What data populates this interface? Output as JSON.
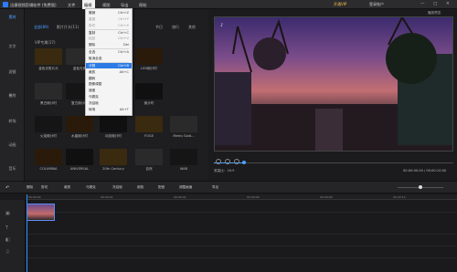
{
  "titlebar": {
    "app_title": "迅捷视频剪辑软件 (免费版)",
    "menu": [
      "文件",
      "编辑",
      "视图",
      "导出",
      "帮助"
    ],
    "vip": "开通VIP",
    "account": "登录账户",
    "window_controls": [
      "—",
      "□",
      "✕"
    ]
  },
  "sidebar": {
    "items": [
      "素材",
      "文字",
      "滤镜",
      "叠附",
      "转场",
      "动画",
      "音乐"
    ],
    "active_index": 0
  },
  "library": {
    "tabs": [
      "全部(89)",
      "影片片头(11)",
      "电影",
      "婚庆",
      "节日",
      "旅行",
      "其他"
    ],
    "active_tab": 0,
    "vip_label": "VIP专属(17)",
    "rows": [
      [
        {
          "label": "金色光斑片头"
        },
        {
          "label": "金色光斑"
        },
        {
          "label": "VIP"
        },
        {
          "label": "LED倒计时"
        }
      ],
      [
        {
          "label": "黑白倒计时"
        },
        {
          "label": "复古倒计时"
        },
        {
          "label": "古典倒计时"
        },
        {
          "label": "倒计时"
        }
      ],
      [
        {
          "label": "火焰倒计时"
        },
        {
          "label": "水晶倒计时"
        },
        {
          "label": "动态倒计时"
        },
        {
          "label": "FOGE"
        },
        {
          "label": "Metro Gold..."
        }
      ],
      [
        {
          "label": "COLUMBIA"
        },
        {
          "label": "UNIVERSAL"
        },
        {
          "label": "20th Century"
        },
        {
          "label": "自然"
        },
        {
          "label": "WAR"
        }
      ]
    ]
  },
  "edit_menu": {
    "items": [
      {
        "label": "撤销",
        "shortcut": "Ctrl+Z",
        "disabled": false
      },
      {
        "label": "重做",
        "shortcut": "Ctrl+Y",
        "disabled": true
      },
      {
        "label": "剪切",
        "shortcut": "Ctrl+X",
        "disabled": true
      },
      {
        "label": "复制",
        "shortcut": "Ctrl+C",
        "disabled": false
      },
      {
        "label": "粘贴",
        "shortcut": "Ctrl+V",
        "disabled": true
      },
      {
        "label": "删除",
        "shortcut": "Del",
        "disabled": false
      },
      {
        "label": "全选",
        "shortcut": "Ctrl+A",
        "disabled": false
      },
      {
        "label": "取消全选",
        "shortcut": "",
        "disabled": false
      },
      {
        "label": "分割",
        "shortcut": "Ctrl+B",
        "disabled": false,
        "highlight": true
      },
      {
        "label": "裁剪",
        "shortcut": "Alt+C",
        "disabled": false
      },
      {
        "label": "翻转",
        "shortcut": "",
        "disabled": false
      },
      {
        "label": "图像调整",
        "shortcut": "",
        "disabled": false
      },
      {
        "label": "速度",
        "shortcut": "",
        "disabled": false
      },
      {
        "label": "马赛克",
        "shortcut": "",
        "disabled": false
      },
      {
        "label": "冻结帧",
        "shortcut": "",
        "disabled": false
      },
      {
        "label": "转场",
        "shortcut": "Alt+T",
        "disabled": false
      }
    ]
  },
  "preview": {
    "label": "播放预览",
    "ratio": "宽高比：16:9",
    "time": "00:00:00.00 / 00:00:10.00"
  },
  "toolbar": {
    "buttons": [
      "撤销",
      "删除",
      "剪切",
      "裁剪",
      "马赛克",
      "冻结帧",
      "倒放",
      "配音",
      "调整画面",
      "导出"
    ]
  },
  "timeline": {
    "ruler": [
      "00:00:00",
      "00:00:02",
      "00:00:04",
      "00:00:06",
      "00:00:08",
      "00:00:10"
    ]
  },
  "colors": {
    "accent": "#2c7be5",
    "vip": "#f5c04b"
  }
}
